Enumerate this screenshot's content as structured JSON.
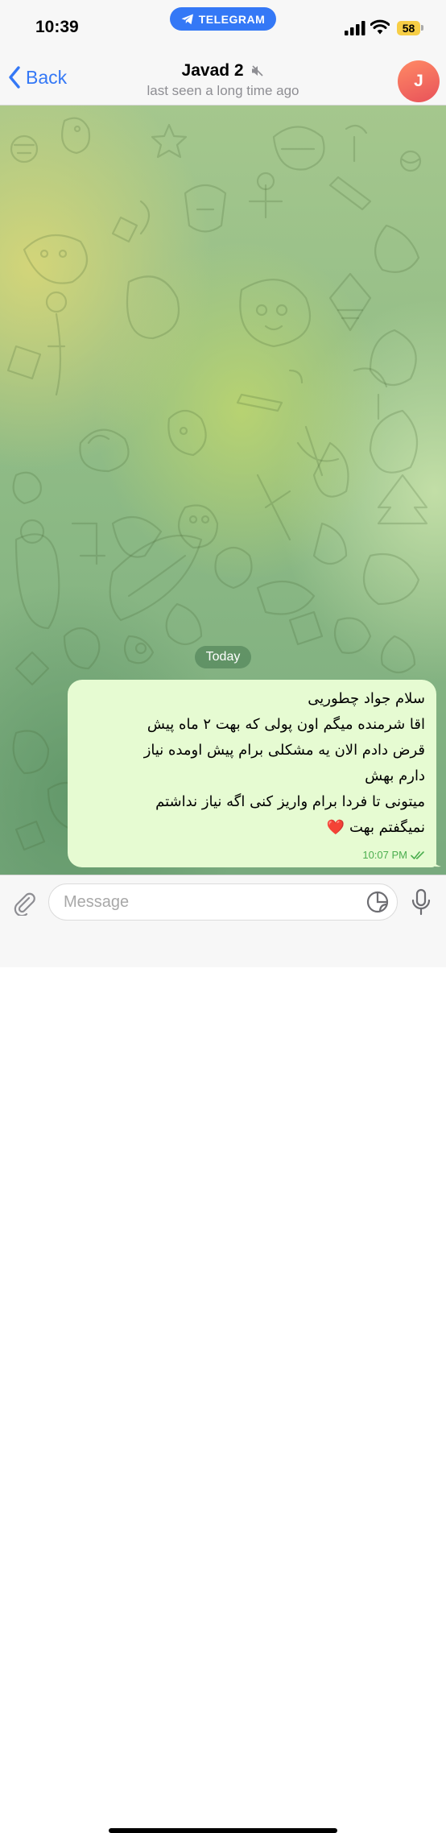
{
  "status_bar": {
    "time": "10:39",
    "app_pill": "TELEGRAM",
    "battery": "58"
  },
  "nav": {
    "back_label": "Back",
    "title": "Javad 2",
    "subtitle": "last seen a long time ago",
    "avatar_initial": "J"
  },
  "chat": {
    "date_label": "Today",
    "message": {
      "lines": [
        "سلام جواد چطوریی",
        "اقا شرمنده میگم اون پولی که بهت ۲ ماه پیش",
        "قرض دادم الان یه مشکلی برام پیش اومده نیاز",
        "دارم بهش",
        "میتونی تا فردا برام واریز کنی اگه نیاز نداشتم",
        "نمیگفتم بهت ❤️"
      ],
      "time": "10:07 PM",
      "status": "read"
    }
  },
  "input": {
    "placeholder": "Message"
  },
  "icons": {
    "back": "chevron-left-icon",
    "mute": "muted-speaker-icon",
    "telegram": "telegram-plane-icon",
    "attach": "paperclip-icon",
    "sticker": "sticker-icon",
    "mic": "microphone-icon",
    "read": "double-check-icon"
  },
  "colors": {
    "accent": "#3478f6",
    "bubble": "#e6fbd2",
    "read_check": "#4cae4f",
    "date_pill": "#5a8f64",
    "avatar": "#e8525a",
    "battery": "#f7ce46"
  }
}
